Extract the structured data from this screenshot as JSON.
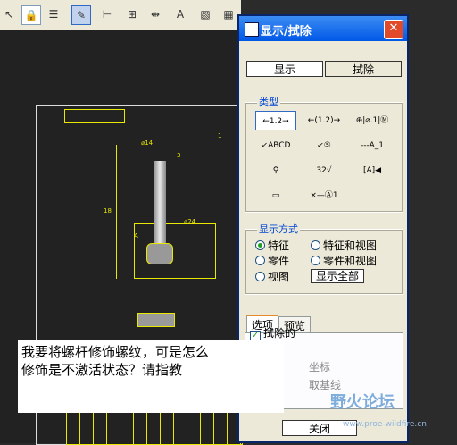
{
  "dialog": {
    "title": "显示/拭除",
    "close_symbol": "✕",
    "show_button": "显示",
    "erase_button": "拭除",
    "type_group_label": "类型",
    "tools": [
      {
        "name": "dimension-tool",
        "label": "←1.2→"
      },
      {
        "name": "reference-dimension-tool",
        "label": "←(1.2)→"
      },
      {
        "name": "geometric-tolerance-tool",
        "label": "⊕|⌀.1|Ⓜ"
      },
      {
        "name": "note-tool",
        "label": "↙ABCD"
      },
      {
        "name": "balloon-tool",
        "label": "↙⑤"
      },
      {
        "name": "axis-tool",
        "label": "---A_1"
      },
      {
        "name": "symbol-tool",
        "label": "⚲"
      },
      {
        "name": "surface-finish-tool",
        "label": "32√"
      },
      {
        "name": "datum-target-tool",
        "label": "[A]◀"
      },
      {
        "name": "cosmetic-feature-tool",
        "label": "▭"
      },
      {
        "name": "datum-target-circle-tool",
        "label": "×—Ⓐ1"
      }
    ],
    "show_mode_label": "显示方式",
    "radios": {
      "feature": "特征",
      "feature_and_view": "特征和视图",
      "part": "零件",
      "part_and_view": "零件和视图",
      "view": "视图"
    },
    "show_all_button": "显示全部",
    "tabs": {
      "options": "选项",
      "preview": "预览"
    },
    "options": {
      "erased_checkbox": "拭除的",
      "partial_label": "坐标",
      "partial_button": "取基线"
    },
    "close_button": "关闭"
  },
  "note": {
    "text_line1": "我要将螺杆修饰螺纹，可是怎么",
    "text_line2": "修饰是不激活状态？请指教"
  },
  "watermark": {
    "name": "野火论坛",
    "url": "www.proe-wildfire.cn"
  },
  "drawing": {
    "labels": [
      "⌀14",
      "18",
      "⌀24",
      "3",
      "1",
      "A"
    ]
  }
}
